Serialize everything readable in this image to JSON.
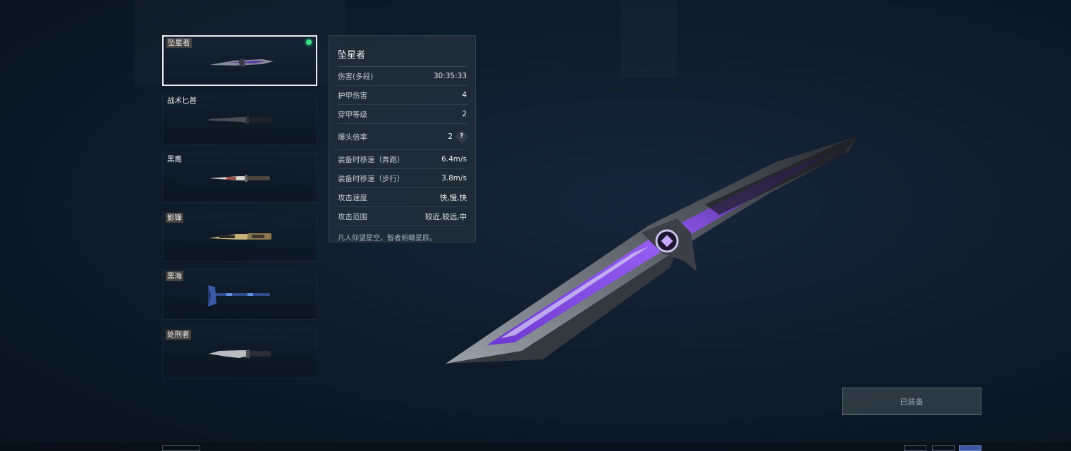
{
  "weapons": [
    {
      "name": "坠星者",
      "selected": true,
      "equipped": true,
      "tagged": true
    },
    {
      "name": "战术匕首",
      "selected": false,
      "equipped": false,
      "tagged": false
    },
    {
      "name": "黑鹰",
      "selected": false,
      "equipped": false,
      "tagged": false
    },
    {
      "name": "影锋",
      "selected": false,
      "equipped": false,
      "tagged": true
    },
    {
      "name": "黑海",
      "selected": false,
      "equipped": false,
      "tagged": true
    },
    {
      "name": "处刑者",
      "selected": false,
      "equipped": false,
      "tagged": true
    }
  ],
  "stats": {
    "title": "坠星者",
    "rows": [
      {
        "label": "伤害(多段)",
        "value": "30:35:33"
      },
      {
        "label": "护甲伤害",
        "value": "4"
      },
      {
        "label": "穿甲等级",
        "value": "2"
      },
      {
        "label": "爆头倍率",
        "value": "2",
        "help": "?"
      },
      {
        "label": "装备时移速（奔跑）",
        "value": "6.4m/s"
      },
      {
        "label": "装备时移速（步行）",
        "value": "3.8m/s"
      },
      {
        "label": "攻击速度",
        "value": "快,慢,快"
      },
      {
        "label": "攻击范围",
        "value": "较近,较远,中"
      }
    ],
    "flavor": "凡人仰望星空，智者俯瞰星辰。"
  },
  "equip_button": {
    "label": "已装备"
  },
  "colors": {
    "accent_purple": "#7b3cf0",
    "equipped_dot": "#3ce08a",
    "background": "#0f1c2b"
  }
}
